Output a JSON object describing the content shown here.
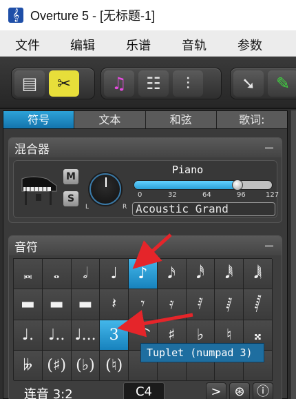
{
  "window": {
    "title": "Overture 5 - [无标题-1]"
  },
  "menu": [
    "文件",
    "编辑",
    "乐谱",
    "音轨",
    "参数"
  ],
  "toolbar": {
    "groups": [
      {
        "buttons": [
          {
            "icon": "list-icon",
            "glyph": "▤",
            "active": false
          },
          {
            "icon": "tools-icon",
            "glyph": "✂",
            "active": true
          }
        ]
      },
      {
        "buttons": [
          {
            "icon": "music-note-icon",
            "glyph": "♫",
            "active": false
          },
          {
            "icon": "tracks-icon",
            "glyph": "☷",
            "active": false
          },
          {
            "icon": "mixer-icon",
            "glyph": "⫶",
            "active": false
          }
        ]
      },
      {
        "buttons": [
          {
            "icon": "pointer-icon",
            "glyph": "➘",
            "active": false
          },
          {
            "icon": "pencil-icon",
            "glyph": "✎",
            "active": false
          }
        ]
      }
    ]
  },
  "panel": {
    "tabs": [
      {
        "label": "符号",
        "active": true
      },
      {
        "label": "文本",
        "active": false
      },
      {
        "label": "和弦",
        "active": false
      },
      {
        "label": "歌词:",
        "active": false
      }
    ],
    "mixer": {
      "title": "混合器",
      "mute": "M",
      "solo": "S",
      "pan_left": "L",
      "pan_right": "R",
      "instrument_label": "Piano",
      "volume": 0.75,
      "volume_value": 96,
      "ticks": [
        "0",
        "32",
        "64",
        "96",
        "127"
      ],
      "instrument_name": "Acoustic Grand"
    },
    "notes": {
      "title": "音符",
      "grid": [
        [
          "𝅜",
          "𝅝",
          "𝅗𝅥",
          "♩",
          "♪",
          "𝅘𝅥𝅯",
          "𝅘𝅥𝅰",
          "𝅘𝅥𝅱",
          "𝅘𝅥𝅲"
        ],
        [
          "▬",
          "▬",
          "▬",
          "𝄽",
          "𝄾",
          "𝄿",
          "𝅀",
          "𝅁",
          "𝅂"
        ],
        [
          "♩.",
          "♩..",
          "♩...",
          "3",
          "⌒",
          "♯",
          "♭",
          "♮",
          "𝄪"
        ],
        [
          "𝄫",
          "(♯)",
          "(♭)",
          "(♮)",
          "",
          "",
          "",
          "",
          ""
        ]
      ],
      "selected_cells": [
        [
          0,
          4
        ],
        [
          2,
          3
        ]
      ],
      "tuplet_label": "连音 3:2",
      "pitch": "C4",
      "play_button": ">",
      "tooltip": "Tuplet (numpad 3)"
    }
  }
}
